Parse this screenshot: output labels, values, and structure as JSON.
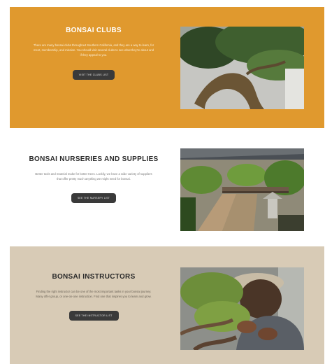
{
  "sections": [
    {
      "title": "BONSAI CLUBS",
      "description": "There are many bonsai clubs throughout Southern California, and they are a way to learn, for meet, membership, and mission. You should visit several clubs to see what they're about and if they appeal to you.",
      "button": "VISIT THE CLUBS LIST",
      "image_icon": "bonsai-tree-closeup"
    },
    {
      "title": "BONSAI NURSERIES AND SUPPLIES",
      "description": "Better tools and material make for better trees. Luckily, we have a wide variety of suppliers that offer pretty much anything we might need for bonsai.",
      "button": "SEE THE NURSERY LIST",
      "image_icon": "bonsai-nursery"
    },
    {
      "title": "BONSAI INSTRUCTORS",
      "description": "Finding the right instructor can be one of the most important tasks in your bonsai journey. Many offer group, or one-on-one instruction. Find one that inspires you to learn and grow.",
      "button": "SEE THE INSTRUCTOR LIST",
      "image_icon": "person-pruning-bonsai"
    }
  ]
}
